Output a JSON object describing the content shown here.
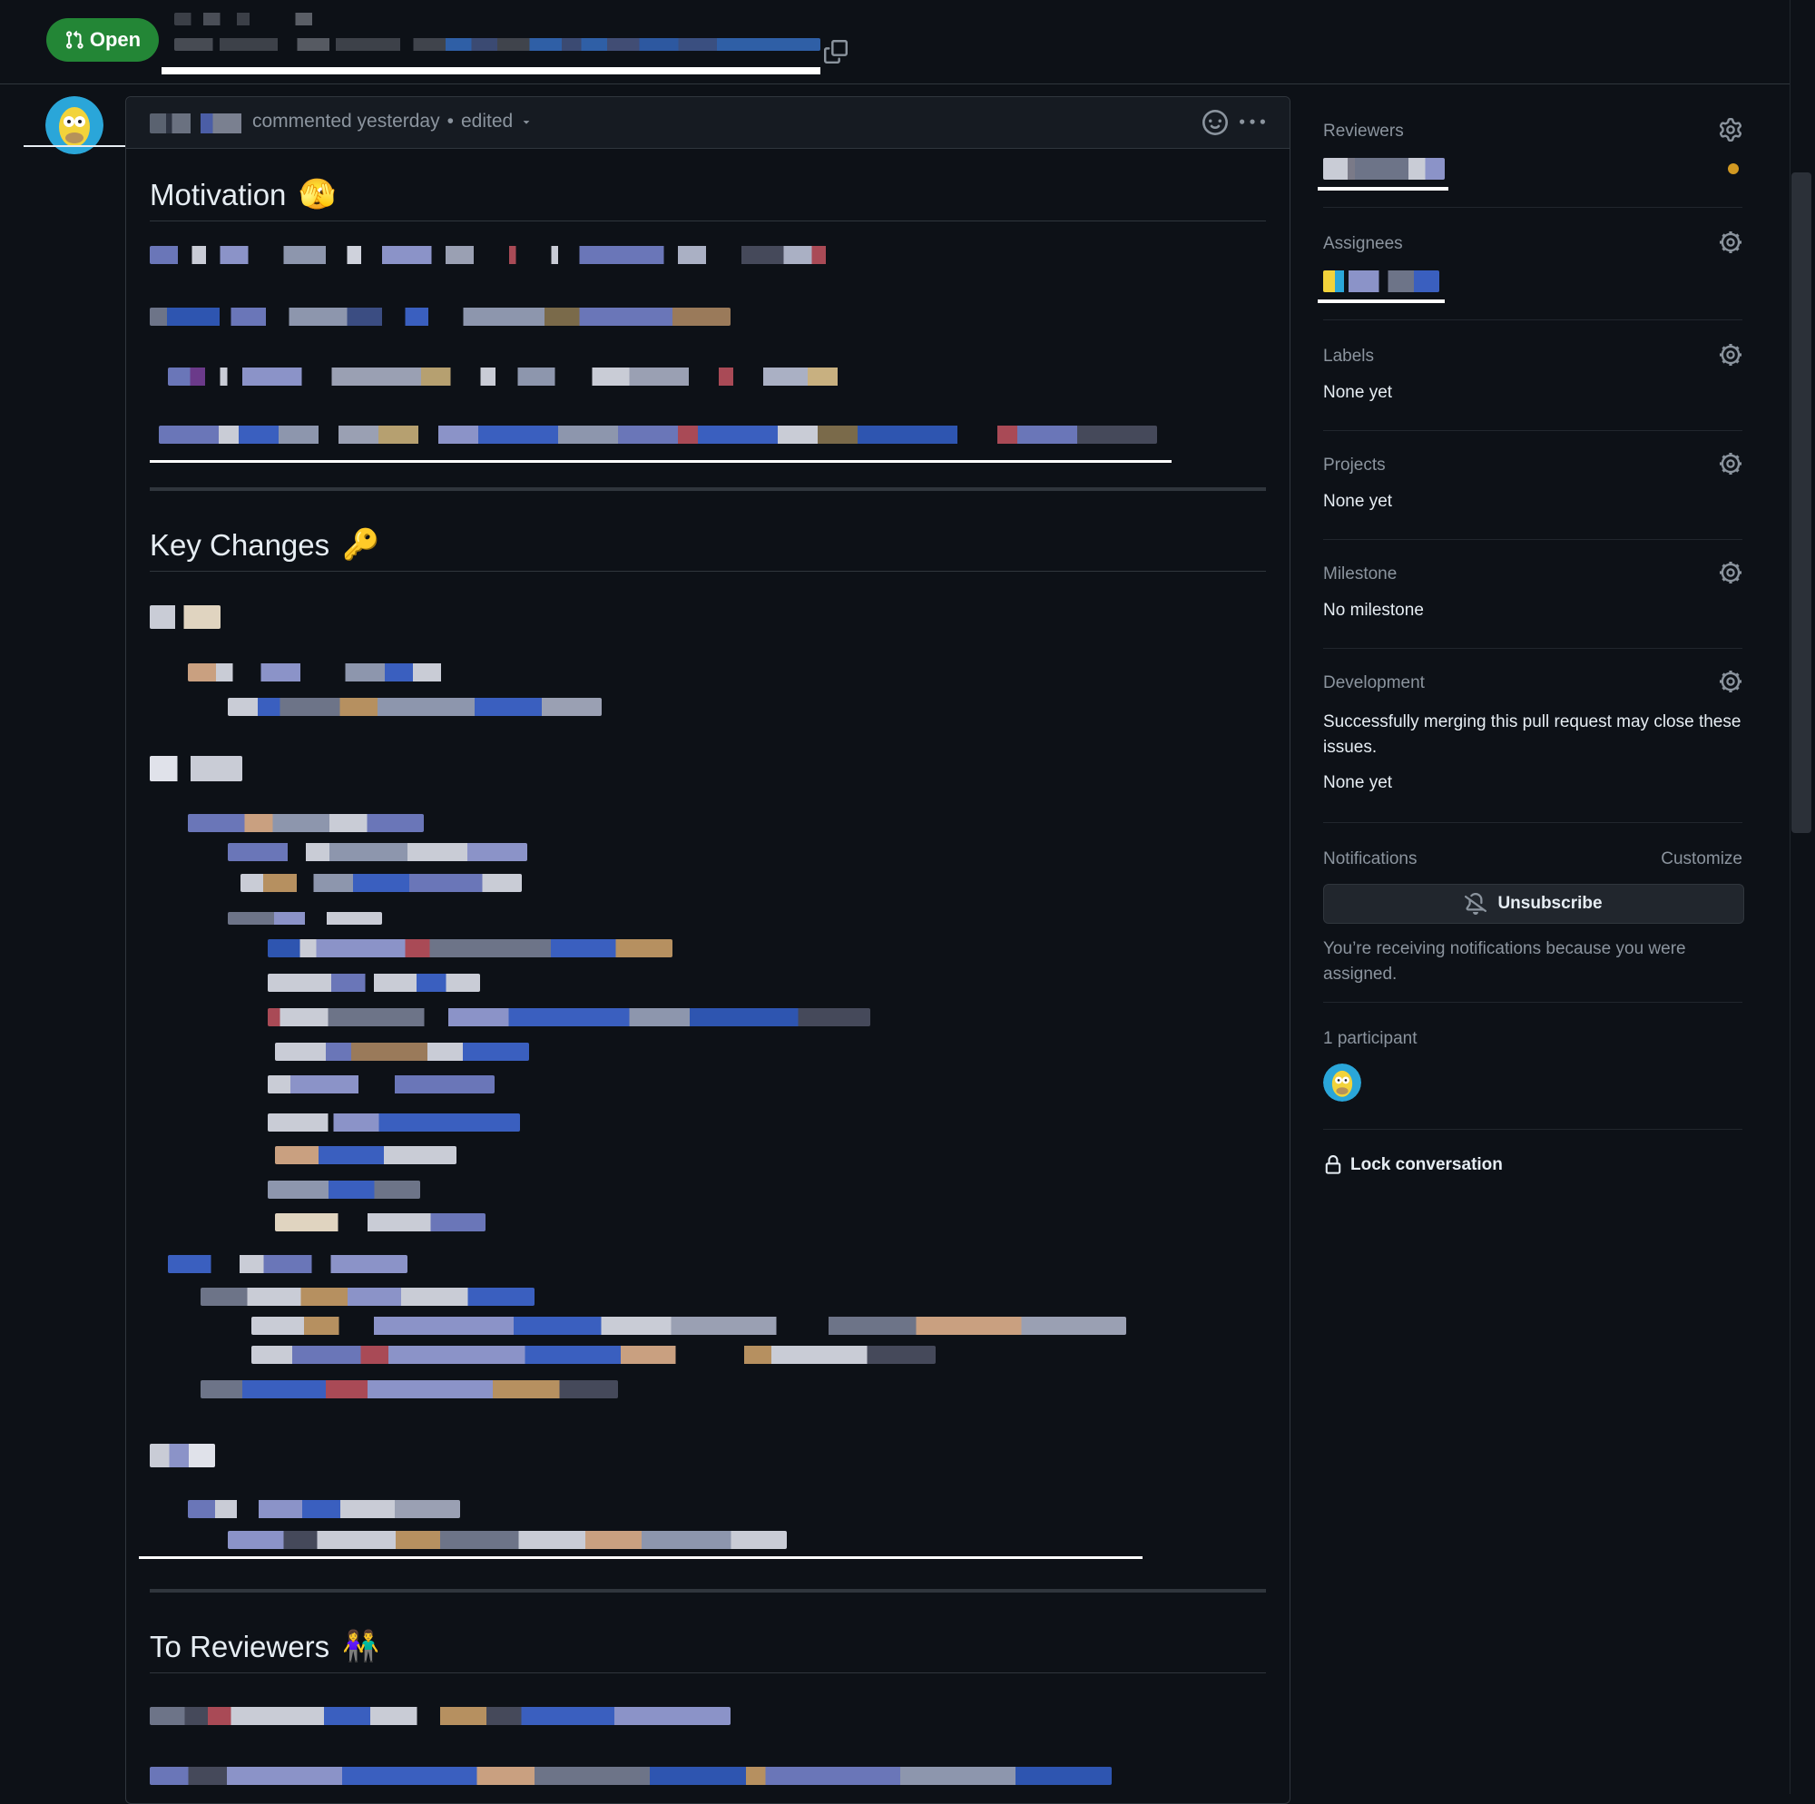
{
  "header": {
    "state_label": "Open"
  },
  "comment": {
    "action": "commented yesterday",
    "separator": "•",
    "edited_label": "edited",
    "sections": [
      {
        "heading": "Motivation",
        "emoji": "🫣"
      },
      {
        "heading": "Key Changes",
        "emoji": "🔑"
      },
      {
        "heading": "To Reviewers",
        "emoji": "👫"
      }
    ]
  },
  "sidebar": {
    "reviewers": {
      "title": "Reviewers"
    },
    "assignees": {
      "title": "Assignees"
    },
    "labels": {
      "title": "Labels",
      "value": "None yet"
    },
    "projects": {
      "title": "Projects",
      "value": "None yet"
    },
    "milestone": {
      "title": "Milestone",
      "value": "No milestone"
    },
    "development": {
      "title": "Development",
      "description": "Successfully merging this pull request may close these issues.",
      "value": "None yet"
    },
    "notifications": {
      "title": "Notifications",
      "customize_label": "Customize",
      "unsubscribe_label": "Unsubscribe",
      "reason": "You’re receiving notifications because you were assigned."
    },
    "participants": {
      "title": "1 participant"
    },
    "lock": {
      "label": "Lock conversation"
    }
  },
  "colors": {
    "background": "#0d1117",
    "open_badge": "#238636",
    "border": "#30363d",
    "muted_text": "#8b949e",
    "pending_review_dot": "#d29922"
  }
}
